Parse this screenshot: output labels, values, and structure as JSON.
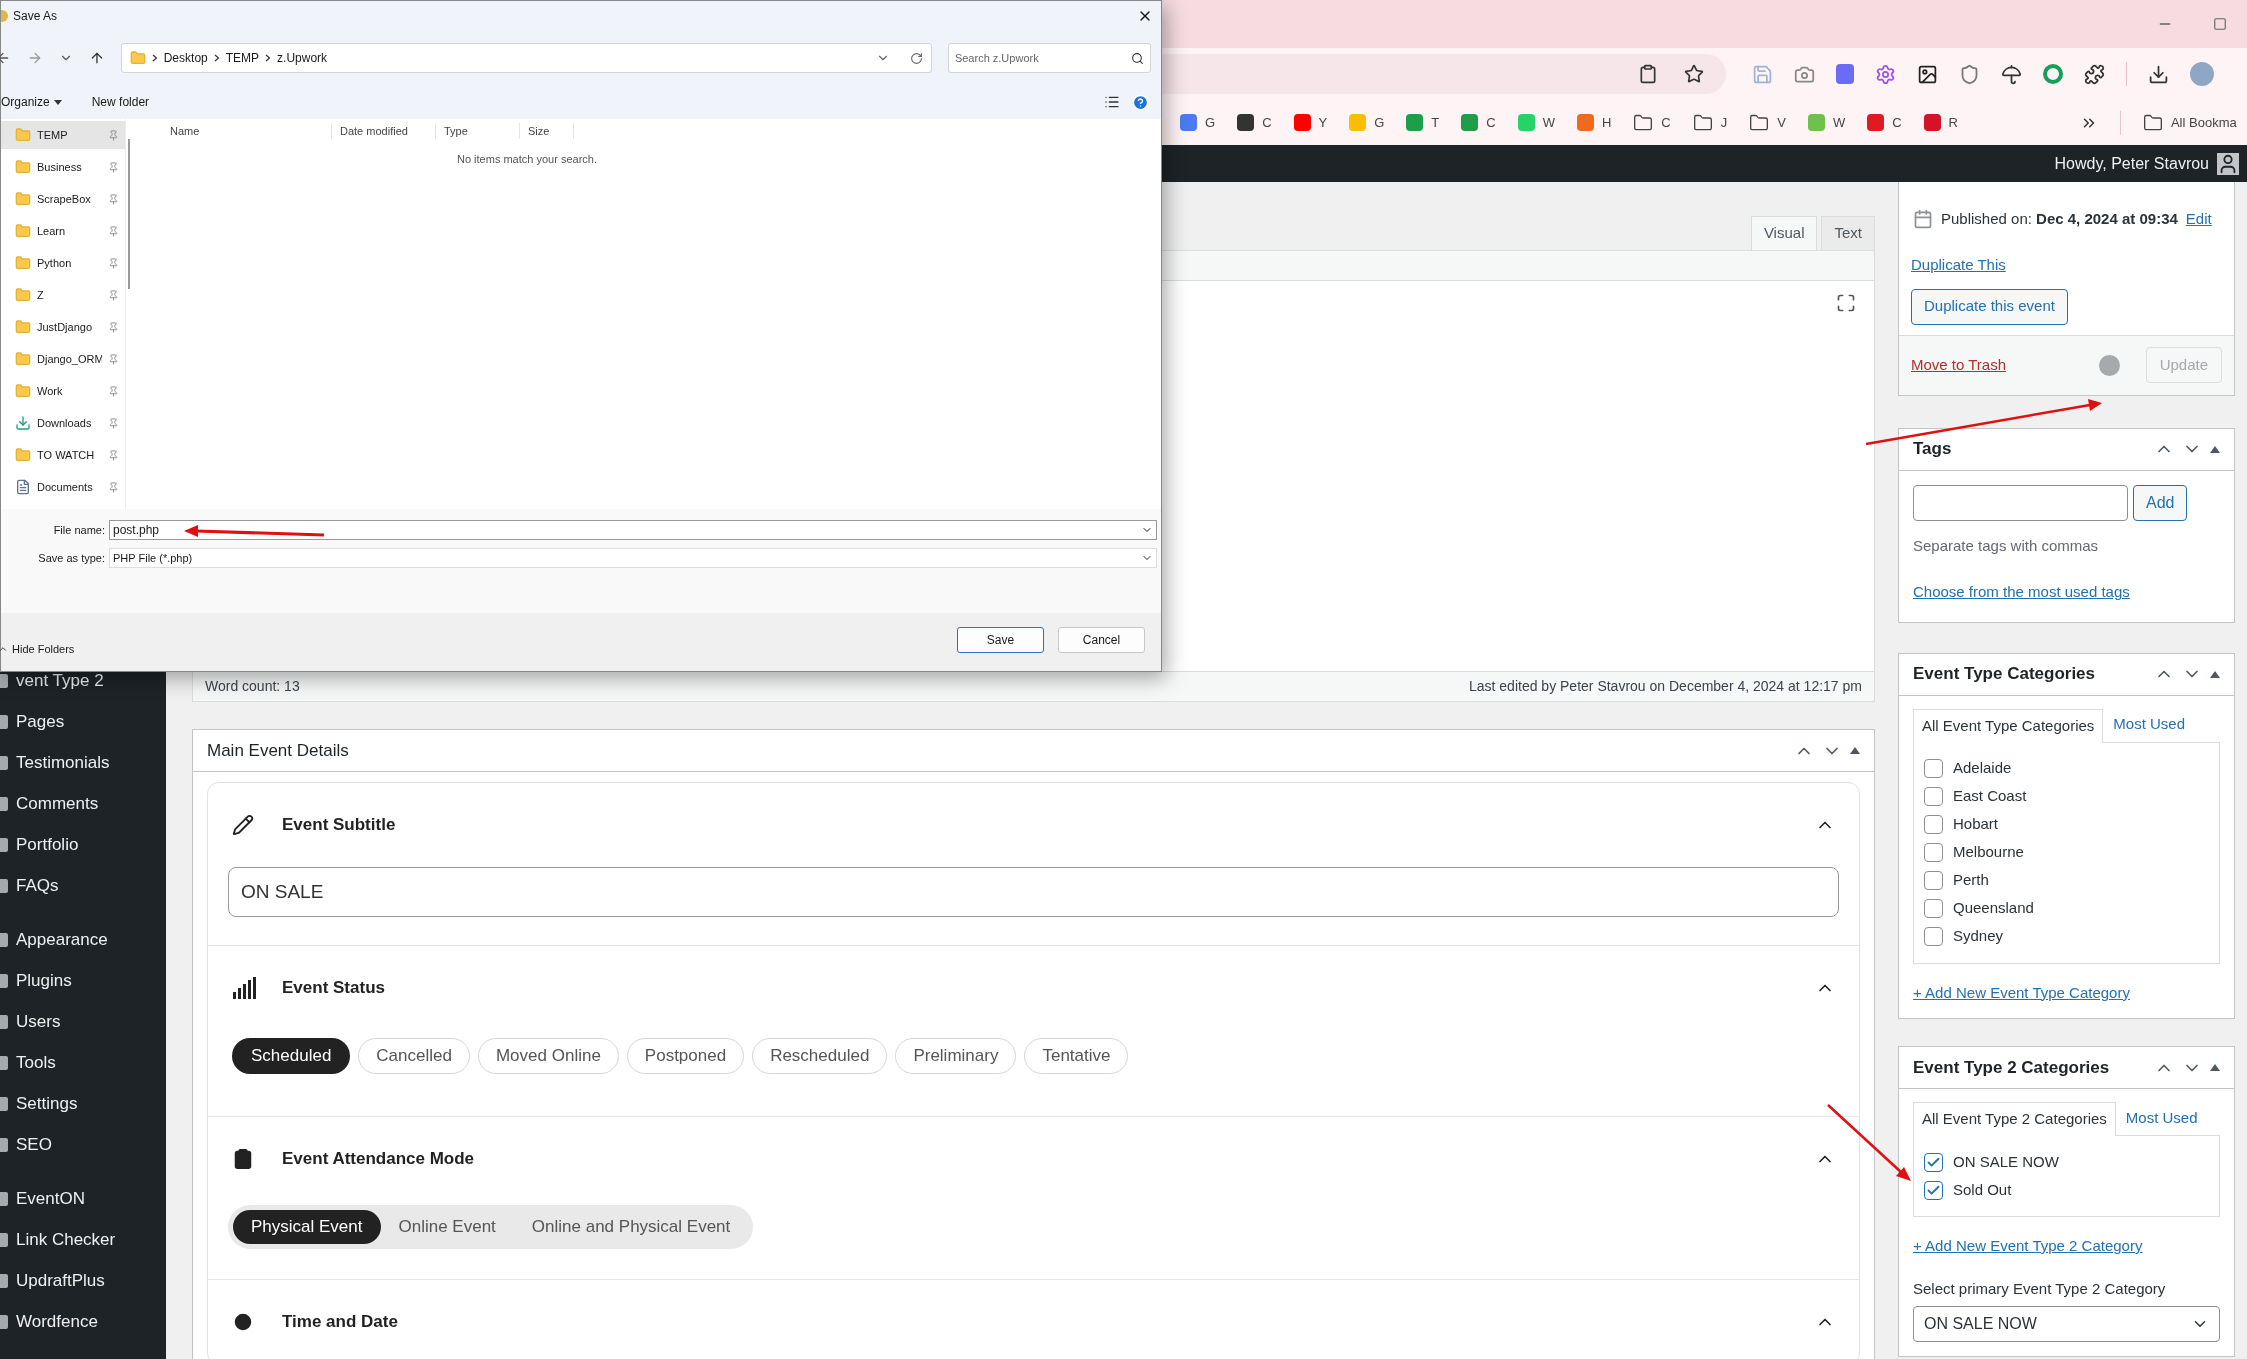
{
  "browser": {
    "bookmarks": [
      {
        "label": "G",
        "kind": "site",
        "color": "#4a7cf0"
      },
      {
        "label": "C",
        "kind": "site",
        "color": "#333333"
      },
      {
        "label": "Y",
        "kind": "site",
        "color": "#ff0000"
      },
      {
        "label": "G",
        "kind": "site",
        "color": "#fbbc04"
      },
      {
        "label": "T",
        "kind": "site",
        "color": "#1e9e4a"
      },
      {
        "label": "C",
        "kind": "site",
        "color": "#1e9e4a"
      },
      {
        "label": "W",
        "kind": "site",
        "color": "#25d366"
      },
      {
        "label": "H",
        "kind": "site",
        "color": "#f06a1c"
      },
      {
        "label": "C",
        "kind": "folder"
      },
      {
        "label": "J",
        "kind": "folder"
      },
      {
        "label": "V",
        "kind": "folder"
      },
      {
        "label": "W",
        "kind": "site",
        "color": "#6cc24a"
      },
      {
        "label": "C",
        "kind": "site",
        "color": "#e01a22"
      },
      {
        "label": "R",
        "kind": "site",
        "color": "#d4132a"
      }
    ],
    "all_bookmarks": "All Bookma"
  },
  "admin_bar": {
    "greeting": "Howdy, Peter Stavrou"
  },
  "admin_menu": [
    {
      "items": [
        "vent Type 2",
        "Pages",
        "Testimonials",
        "Comments",
        "Portfolio",
        "FAQs"
      ]
    },
    {
      "items": [
        "Appearance",
        "Plugins",
        "Users",
        "Tools",
        "Settings",
        "SEO"
      ]
    },
    {
      "items": [
        "EventON",
        "Link Checker",
        "UpdraftPlus",
        "Wordfence"
      ]
    }
  ],
  "editor": {
    "tabs": [
      {
        "label": "Visual",
        "selected": true
      },
      {
        "label": "Text",
        "selected": false
      }
    ],
    "word_count": "Word count: 13",
    "last_edited": "Last edited by Peter Stavrou on December 4, 2024 at 12:17 pm"
  },
  "main_event_details": {
    "title": "Main Event Details",
    "sections": [
      {
        "kind": "subtitle",
        "title": "Event Subtitle",
        "value": "ON SALE"
      },
      {
        "kind": "status",
        "title": "Event Status",
        "options": [
          {
            "label": "Scheduled",
            "selected": true
          },
          {
            "label": "Cancelled",
            "selected": false
          },
          {
            "label": "Moved Online",
            "selected": false
          },
          {
            "label": "Postponed",
            "selected": false
          },
          {
            "label": "Rescheduled",
            "selected": false
          },
          {
            "label": "Preliminary",
            "selected": false
          },
          {
            "label": "Tentative",
            "selected": false
          }
        ]
      },
      {
        "kind": "attendance",
        "title": "Event Attendance Mode",
        "options": [
          {
            "label": "Physical Event",
            "selected": true
          },
          {
            "label": "Online Event",
            "selected": false
          },
          {
            "label": "Online and Physical Event",
            "selected": false
          }
        ]
      },
      {
        "kind": "time",
        "title": "Time and Date"
      }
    ]
  },
  "publish": {
    "published_label": "Published on:",
    "published_value": "Dec 4, 2024 at 09:34",
    "edit_link": "Edit",
    "duplicate_link": "Duplicate This",
    "duplicate_button": "Duplicate this event",
    "trash_link": "Move to Trash",
    "update_button": {
      "label": "Update",
      "disabled": true
    }
  },
  "tags": {
    "title": "Tags",
    "add_button": "Add",
    "hint": "Separate tags with commas",
    "link": "Choose from the most used tags"
  },
  "event_type_categories": {
    "title": "Event Type Categories",
    "tabs": [
      {
        "label": "All Event Type Categories",
        "selected": true
      },
      {
        "label": "Most Used",
        "selected": false
      }
    ],
    "items": [
      {
        "label": "Adelaide",
        "checked": false
      },
      {
        "label": "East Coast",
        "checked": false
      },
      {
        "label": "Hobart",
        "checked": false
      },
      {
        "label": "Melbourne",
        "checked": false
      },
      {
        "label": "Perth",
        "checked": false
      },
      {
        "label": "Queensland",
        "checked": false
      },
      {
        "label": "Sydney",
        "checked": false
      }
    ],
    "add_link": "+ Add New Event Type Category"
  },
  "event_type_2_categories": {
    "title": "Event Type 2 Categories",
    "tabs": [
      {
        "label": "All Event Type 2 Categories",
        "selected": true
      },
      {
        "label": "Most Used",
        "selected": false
      }
    ],
    "items": [
      {
        "label": "ON SALE NOW",
        "checked": true
      },
      {
        "label": "Sold Out",
        "checked": true
      }
    ],
    "add_link": "+ Add New Event Type 2 Category",
    "primary_label": "Select primary Event Type 2 Category",
    "primary_value": "ON SALE NOW"
  },
  "dialog": {
    "title": "Save As",
    "breadcrumb": [
      "Desktop",
      "TEMP",
      "z.Upwork"
    ],
    "search_placeholder": "Search z.Upwork",
    "organize": "Organize",
    "new_folder": "New folder",
    "nav_items": [
      {
        "label": "TEMP",
        "kind": "folder",
        "selected": true
      },
      {
        "label": "Business",
        "kind": "folder",
        "selected": false
      },
      {
        "label": "ScrapeBox",
        "kind": "folder",
        "selected": false
      },
      {
        "label": "Learn",
        "kind": "folder",
        "selected": false
      },
      {
        "label": "Python",
        "kind": "folder",
        "selected": false
      },
      {
        "label": "Z",
        "kind": "folder",
        "selected": false
      },
      {
        "label": "JustDjango",
        "kind": "folder",
        "selected": false
      },
      {
        "label": "Django_ORM",
        "kind": "folder",
        "selected": false
      },
      {
        "label": "Work",
        "kind": "folder",
        "selected": false
      },
      {
        "label": "Downloads",
        "kind": "download",
        "selected": false
      },
      {
        "label": "TO WATCH",
        "kind": "folder",
        "selected": false
      },
      {
        "label": "Documents",
        "kind": "documents",
        "selected": false
      }
    ],
    "columns": [
      "Name",
      "Date modified",
      "Type",
      "Size"
    ],
    "empty_message": "No items match your search.",
    "file_name_label": "File name:",
    "file_name": "post.php",
    "type_label": "Save as type:",
    "type_value": "PHP File (*.php)",
    "hide_folders": "Hide Folders",
    "buttons": [
      {
        "label": "Save",
        "kind": "primary"
      },
      {
        "label": "Cancel",
        "kind": "secondary"
      }
    ]
  }
}
